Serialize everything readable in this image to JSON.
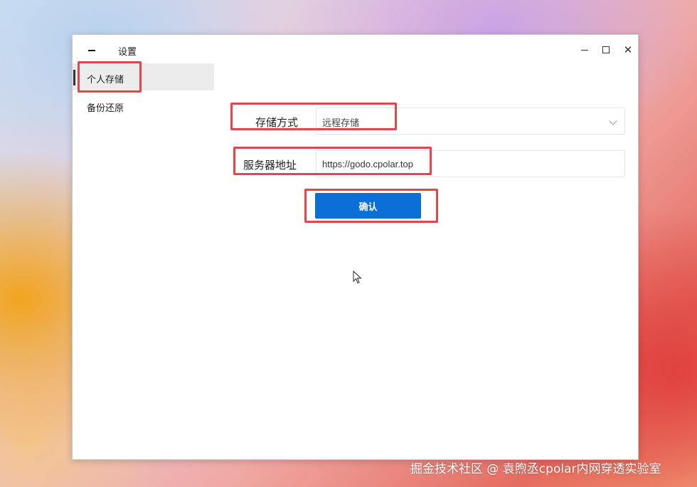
{
  "window": {
    "title": "设置",
    "controls": {
      "minimize": "minimize",
      "maximize": "maximize",
      "close": "✕"
    }
  },
  "sidebar": {
    "items": [
      {
        "label": "个人存储",
        "active": true
      },
      {
        "label": "备份还原",
        "active": false
      }
    ]
  },
  "form": {
    "storage_mode": {
      "label": "存储方式",
      "value": "远程存储"
    },
    "server_address": {
      "label": "服务器地址",
      "value": "https://godo.cpolar.top"
    },
    "confirm_label": "确认"
  },
  "watermark": "掘金技术社区 @ 袁煦丞cpolar内网穿透实验室",
  "colors": {
    "accent": "#0a6fd6",
    "highlight_box": "#e0474b"
  }
}
